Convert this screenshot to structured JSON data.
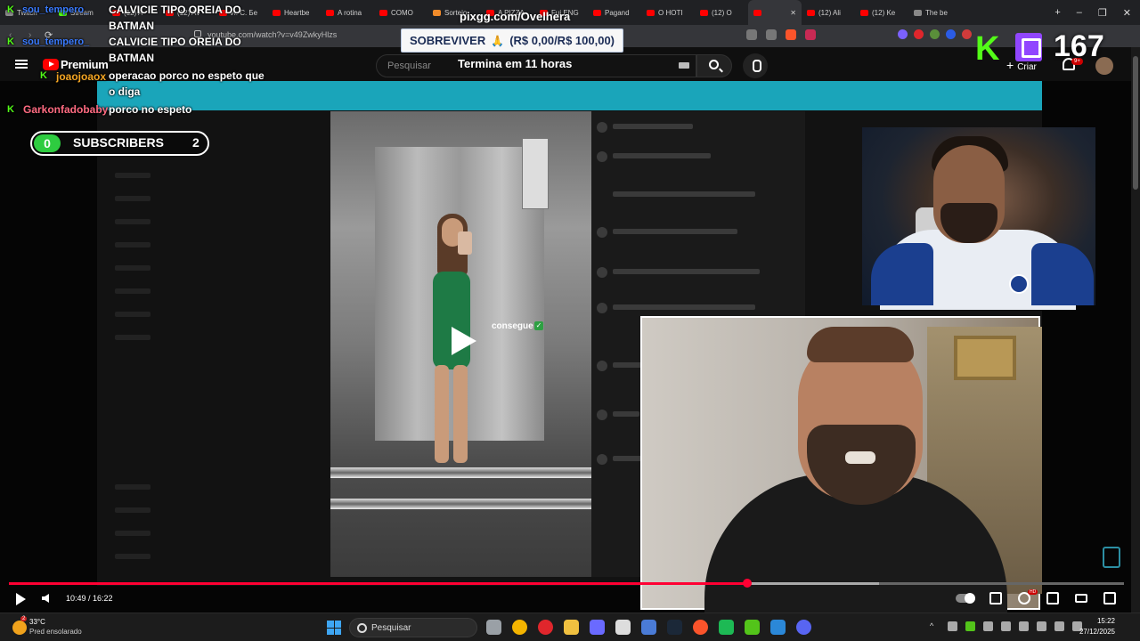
{
  "browser": {
    "tabs": [
      {
        "label": "Twitch",
        "favicon": "gray"
      },
      {
        "label": "Stream",
        "favicon": "kick"
      },
      {
        "label": "(12) A",
        "favicon": "red"
      },
      {
        "label": "(12) AV",
        "favicon": "red"
      },
      {
        "label": "И. С. Бе",
        "favicon": "red"
      },
      {
        "label": "Heartbe",
        "favicon": "red"
      },
      {
        "label": "A rotina",
        "favicon": "red"
      },
      {
        "label": "COMO",
        "favicon": "red"
      },
      {
        "label": "Sorteio",
        "favicon": "orange"
      },
      {
        "label": "A PIZZA",
        "favicon": "red"
      },
      {
        "label": "Fui ENG",
        "favicon": "red"
      },
      {
        "label": "Pagand",
        "favicon": "red"
      },
      {
        "label": "O HOTI",
        "favicon": "red"
      },
      {
        "label": "(12) O",
        "favicon": "red"
      },
      {
        "label": "",
        "favicon": "red",
        "active": true
      },
      {
        "label": "(12) Ali",
        "favicon": "red"
      },
      {
        "label": "(12) Ke",
        "favicon": "red"
      },
      {
        "label": "The be",
        "favicon": "gray"
      }
    ],
    "new_tab_glyph": "+",
    "window_controls": [
      "–",
      "❐",
      "✕"
    ],
    "url": "youtube.com/watch?v=v49ZwkyHlzs"
  },
  "youtube": {
    "logo_text": "Premium",
    "search_placeholder": "Pesquisar",
    "create_label": "Criar",
    "create_glyph": "+",
    "notification_badge": "9+",
    "player": {
      "current_time": "10:49",
      "duration": "16:22",
      "time_display": "10:49 / 16:22",
      "progress_fraction": 0.662,
      "buffer_fraction": 0.78,
      "hd_badge": "HD"
    }
  },
  "overlay": {
    "pix_title": "pixgg.com/Ovelhera",
    "goal_label": "SOBREVIVER",
    "goal_emoji": "🙏",
    "goal_amount": "(R$ 0,00/R$ 100,00)",
    "goal_timer": "Termina em 11 horas",
    "viewer_count": "167",
    "subscribers": {
      "left": "0",
      "label": "SUBSCRIBERS",
      "right": "2"
    },
    "post_caption": "consegue",
    "post_caption_check": "✓",
    "chat": [
      {
        "user": "sou_tempero_",
        "user_color": "#3a7bff",
        "message": "CALVICIE TIPO OREIA DO BATMAN",
        "badge": "K"
      },
      {
        "user": "sou_tempero_",
        "user_color": "#3a7bff",
        "message": "CALVICIE TIPO OREIA DO BATMAN",
        "badge": "K"
      },
      {
        "user": "joaojoaox",
        "user_color": "#f5a623",
        "message": "operacao porco no espeto que o diga",
        "badge": "K"
      },
      {
        "user": "Garkonfadobaby",
        "user_color": "#ff6b81",
        "message": "porco no espeto",
        "badge": "K"
      }
    ]
  },
  "taskbar": {
    "temperature": "33°C",
    "weather_desc": "Pred ensolarado",
    "weather_badge": "2",
    "search_label": "Pesquisar",
    "time": "15:22",
    "date": "27/12/2025",
    "apps": [
      "file-explorer",
      "chrome",
      "opera",
      "folder",
      "app-grid",
      "github",
      "streamer",
      "steam",
      "brave",
      "spotify",
      "terminal",
      "azure",
      "discord"
    ]
  }
}
